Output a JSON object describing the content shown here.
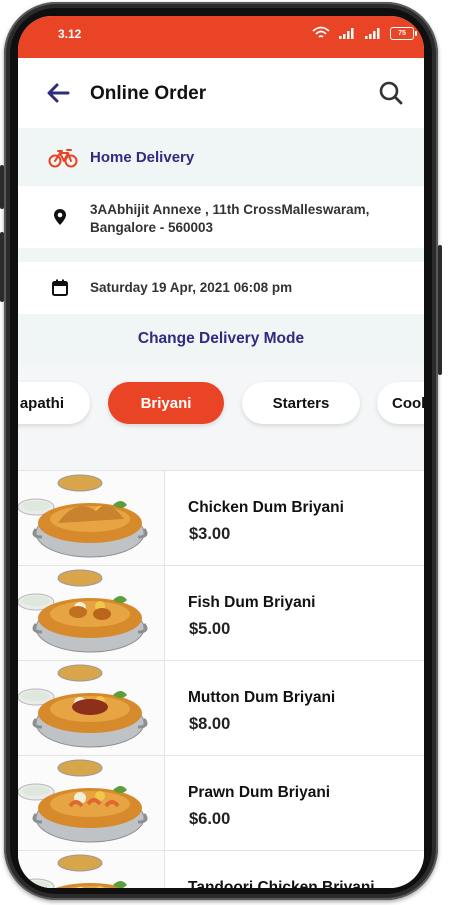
{
  "status_bar": {
    "time": "3.12",
    "battery": "75"
  },
  "header": {
    "title": "Online Order"
  },
  "delivery": {
    "mode_label": "Home Delivery",
    "address_line1": "3AAbhijit Annexe , 11th CrossMalleswaram,",
    "address_line2": "Bangalore - 560003",
    "datetime": "Saturday 19 Apr, 2021 06:08 pm",
    "change_label": "Change Delivery Mode"
  },
  "categories": [
    {
      "label": "apathi",
      "active": false
    },
    {
      "label": "Briyani",
      "active": true
    },
    {
      "label": "Starters",
      "active": false
    },
    {
      "label": "Cool",
      "active": false
    }
  ],
  "items": [
    {
      "name": "Chicken Dum Briyani",
      "price": "$3.00"
    },
    {
      "name": "Fish Dum Briyani",
      "price": "$5.00"
    },
    {
      "name": "Mutton Dum Briyani",
      "price": "$8.00"
    },
    {
      "name": "Prawn Dum Briyani",
      "price": "$6.00"
    },
    {
      "name": "Tandoori Chicken Briyani",
      "price": ""
    }
  ],
  "colors": {
    "accent": "#ea4427",
    "brand_text": "#2e2c7e",
    "band": "#f0f5f5"
  }
}
